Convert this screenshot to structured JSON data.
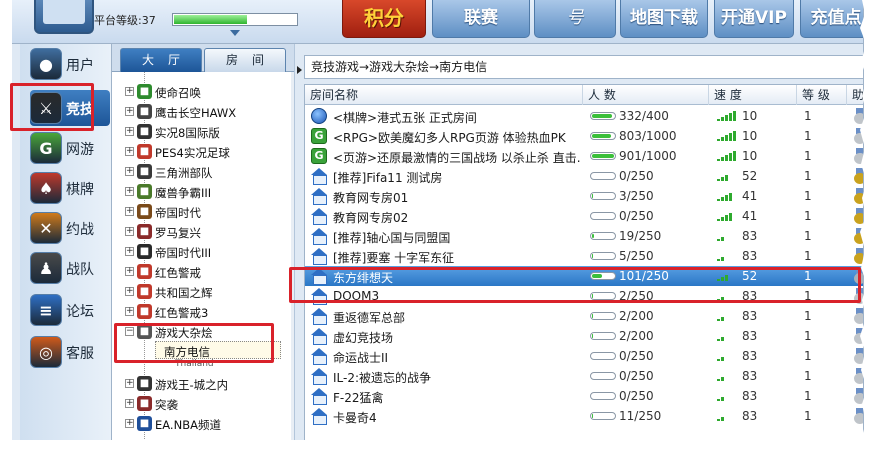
{
  "top": {
    "level_label": "平台等级:37",
    "level_progress": 0.6,
    "buttons": [
      "积分",
      "联赛",
      "号",
      "地图下载",
      "开通VIP",
      "充值点"
    ]
  },
  "nav": {
    "items": [
      {
        "label": "用户",
        "icon": "user-icon",
        "active": false
      },
      {
        "label": "竞技",
        "icon": "compete-icon",
        "active": true
      },
      {
        "label": "网游",
        "icon": "netgame-icon",
        "active": false
      },
      {
        "label": "棋牌",
        "icon": "cards-icon",
        "active": false
      },
      {
        "label": "约战",
        "icon": "battle-icon",
        "active": false
      },
      {
        "label": "战队",
        "icon": "team-icon",
        "active": false
      },
      {
        "label": "论坛",
        "icon": "forum-icon",
        "active": false
      },
      {
        "label": "客服",
        "icon": "service-icon",
        "active": false
      }
    ]
  },
  "tree_tabs": {
    "hall": "大厅",
    "rooms": "房间"
  },
  "tree": {
    "items": [
      {
        "label": "使命召唤",
        "icon": "star-icon",
        "color": "#2e8b2e"
      },
      {
        "label": "鹰击长空HAWX",
        "icon": "jet-icon",
        "color": "#444444"
      },
      {
        "label": "实况8国际版",
        "icon": "soccer-icon",
        "color": "#333333"
      },
      {
        "label": "PES4实况足球",
        "icon": "pes-icon",
        "color": "#c0392b"
      },
      {
        "label": "三角洲部队",
        "icon": "delta-icon",
        "color": "#3a3a3a"
      },
      {
        "label": "魔兽争霸III",
        "icon": "warcraft-icon",
        "color": "#4a7a2a"
      },
      {
        "label": "帝国时代",
        "icon": "empire-icon",
        "color": "#7a4a1a"
      },
      {
        "label": "罗马复兴",
        "icon": "rome-icon",
        "color": "#8a2a2a"
      },
      {
        "label": "帝国时代III",
        "icon": "empire3-icon",
        "color": "#2a2a2a"
      },
      {
        "label": "红色警戒",
        "icon": "redalert-icon",
        "color": "#c0392b"
      },
      {
        "label": "共和国之辉",
        "icon": "republic-icon",
        "color": "#c0392b"
      },
      {
        "label": "红色警戒3",
        "icon": "redalert3-icon",
        "color": "#c0392b"
      },
      {
        "label": "游戏大杂烩",
        "icon": "mixed-games-icon",
        "color": "#555555",
        "expanded": true
      },
      {
        "label": "游戏王-城之内",
        "icon": "yugioh-icon",
        "color": "#333333"
      },
      {
        "label": "突袭",
        "icon": "raid-icon",
        "color": "#8a2a2a"
      },
      {
        "label": "EA.NBA频道",
        "icon": "nba-icon",
        "color": "#1f4f9a"
      }
    ],
    "selected_child": "南方电信",
    "clipped_child": "Thailand"
  },
  "breadcrumb": "竞技游戏→游戏大杂烩→南方电信",
  "table": {
    "headers": [
      "房间名称",
      "人 数",
      "速 度",
      "等 级",
      "助"
    ],
    "rows": [
      {
        "icon": "globe",
        "name": "<棋牌>港式五张 正式房间",
        "count": "332/400",
        "fill": 0.83,
        "speed": "10",
        "bars": 5,
        "level": "1",
        "medal": "gray"
      },
      {
        "icon": "g",
        "name": "<RPG>欧美魔幻多人RPG页游 体验热血PK",
        "count": "803/1000",
        "fill": 0.8,
        "speed": "10",
        "bars": 5,
        "level": "1",
        "medal": "gray"
      },
      {
        "icon": "g",
        "name": "<页游>还原最激情的三国战场 以杀止杀 直击...",
        "count": "901/1000",
        "fill": 0.9,
        "speed": "10",
        "bars": 5,
        "level": "1",
        "medal": "gray"
      },
      {
        "icon": "house",
        "name": "[推荐]Fifa11 测试房",
        "count": "0/250",
        "fill": 0.0,
        "speed": "52",
        "bars": 3,
        "level": "1",
        "medal": "gold"
      },
      {
        "icon": "house",
        "name": "教育网专房01",
        "count": "3/250",
        "fill": 0.02,
        "speed": "41",
        "bars": 4,
        "level": "1",
        "medal": "gold"
      },
      {
        "icon": "house",
        "name": "教育网专房02",
        "count": "0/250",
        "fill": 0.0,
        "speed": "41",
        "bars": 4,
        "level": "1",
        "medal": "gold"
      },
      {
        "icon": "house",
        "name": "[推荐]轴心国与同盟国",
        "count": "19/250",
        "fill": 0.08,
        "speed": "83",
        "bars": 2,
        "level": "1",
        "medal": "gold"
      },
      {
        "icon": "house",
        "name": "[推荐]要塞 十字军东征",
        "count": "5/250",
        "fill": 0.02,
        "speed": "83",
        "bars": 2,
        "level": "1",
        "medal": "gold"
      },
      {
        "icon": "house",
        "name": "东方绯想天",
        "count": "101/250",
        "fill": 0.4,
        "speed": "52",
        "bars": 3,
        "level": "1",
        "medal": "silver",
        "selected": true
      },
      {
        "icon": "house",
        "name": "DOOM3",
        "count": "2/250",
        "fill": 0.01,
        "speed": "83",
        "bars": 2,
        "level": "1",
        "medal": "gray"
      },
      {
        "icon": "house",
        "name": "重返德军总部",
        "count": "2/200",
        "fill": 0.01,
        "speed": "83",
        "bars": 2,
        "level": "1",
        "medal": "gray"
      },
      {
        "icon": "house",
        "name": "虚幻竞技场",
        "count": "2/200",
        "fill": 0.01,
        "speed": "83",
        "bars": 2,
        "level": "1",
        "medal": "gray"
      },
      {
        "icon": "house",
        "name": "命运战士II",
        "count": "0/250",
        "fill": 0.0,
        "speed": "83",
        "bars": 2,
        "level": "1",
        "medal": "gray"
      },
      {
        "icon": "house",
        "name": "IL-2:被遗忘的战争",
        "count": "0/250",
        "fill": 0.0,
        "speed": "83",
        "bars": 2,
        "level": "1",
        "medal": "gray"
      },
      {
        "icon": "house",
        "name": "F-22猛禽",
        "count": "0/250",
        "fill": 0.0,
        "speed": "83",
        "bars": 2,
        "level": "1",
        "medal": "gray"
      },
      {
        "icon": "house",
        "name": "卡曼奇4",
        "count": "11/250",
        "fill": 0.04,
        "speed": "83",
        "bars": 2,
        "level": "1",
        "medal": "gray"
      }
    ]
  },
  "colors": {
    "highlight": "#d9222a",
    "selected_row": "#2a77c6",
    "accent": "#1d5597"
  }
}
